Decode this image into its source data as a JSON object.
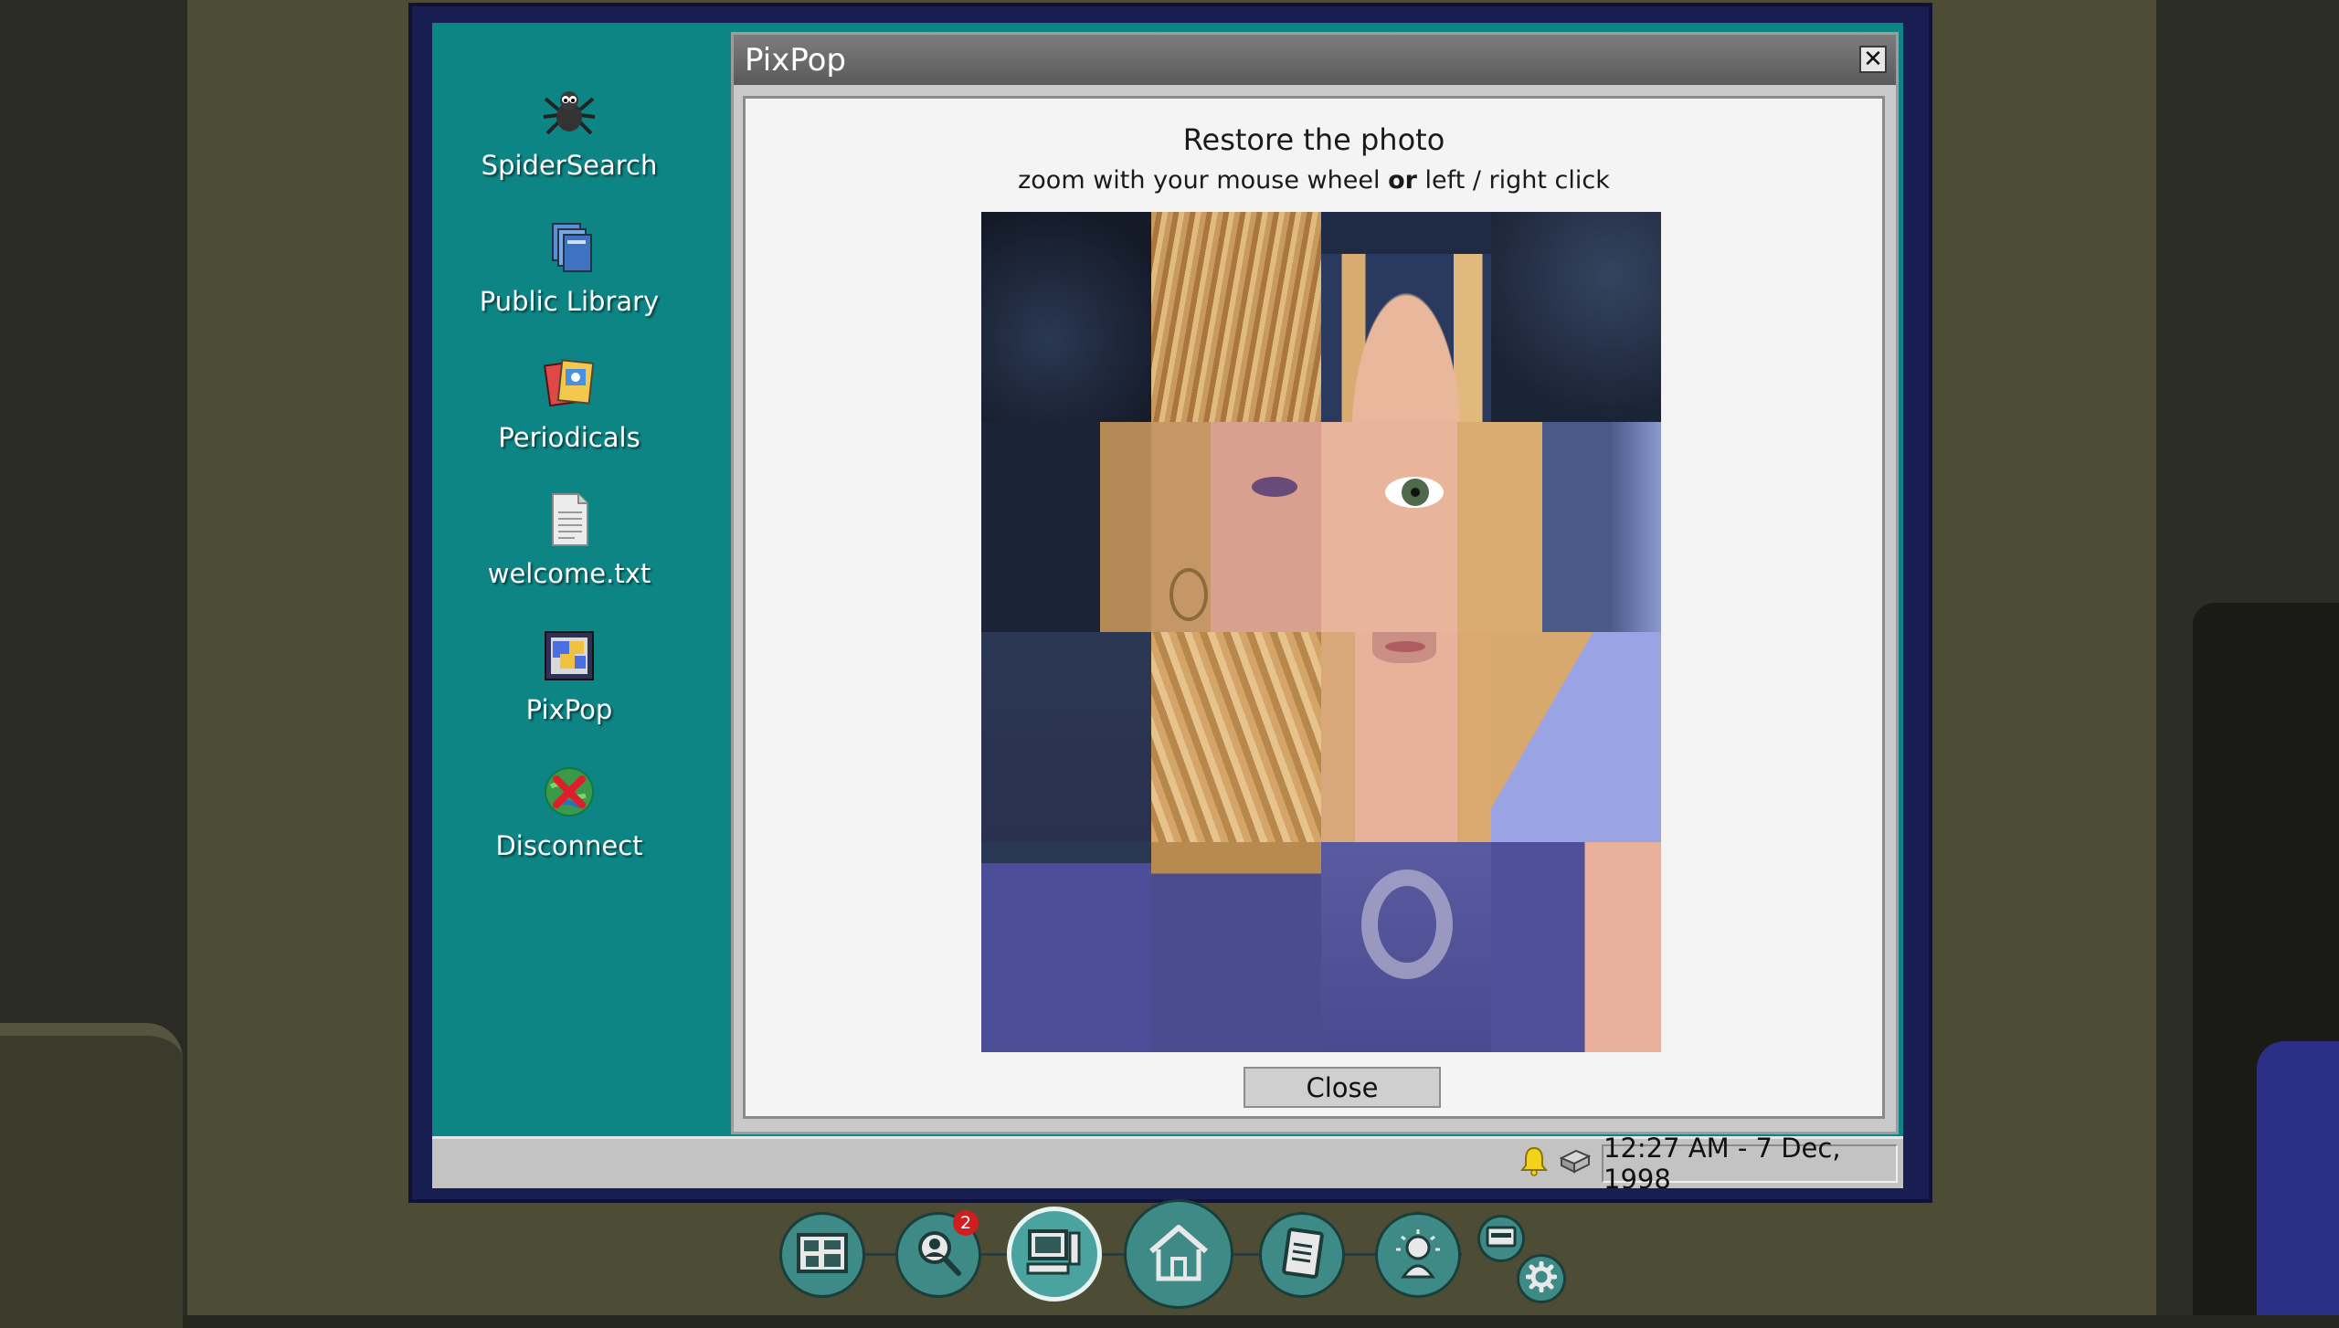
{
  "window": {
    "title": "PixPop"
  },
  "content": {
    "heading": "Restore the photo",
    "instruction_prefix": "zoom with your mouse wheel",
    "instruction_bold": "or",
    "instruction_suffix": "left / right click",
    "close_label": "Close"
  },
  "desktop": {
    "icons": [
      {
        "label": "SpiderSearch",
        "icon": "spider-icon"
      },
      {
        "label": "Public Library",
        "icon": "books-icon"
      },
      {
        "label": "Periodicals",
        "icon": "magazines-icon"
      },
      {
        "label": "welcome.txt",
        "icon": "text-file-icon"
      },
      {
        "label": "PixPop",
        "icon": "pixpop-icon"
      },
      {
        "label": "Disconnect",
        "icon": "disconnect-globe-icon"
      }
    ]
  },
  "taskbar": {
    "clock": "12:27 AM - 7 Dec, 1998"
  },
  "dock": {
    "items": [
      {
        "icon": "evidence-board-icon"
      },
      {
        "icon": "search-person-icon",
        "badge": "2"
      },
      {
        "icon": "computer-icon",
        "active": true
      },
      {
        "icon": "home-icon"
      },
      {
        "icon": "notebook-icon"
      },
      {
        "icon": "idea-bulb-icon"
      },
      {
        "icon": "card-icon"
      },
      {
        "icon": "settings-gear-icon"
      }
    ]
  },
  "colors": {
    "desktop_bg": "#0e8585",
    "titlebar": "#6a6a6a",
    "taskbar": "#c3c3c3",
    "monitor_bezel": "#181d52",
    "dock_accent": "#3d8a86"
  }
}
